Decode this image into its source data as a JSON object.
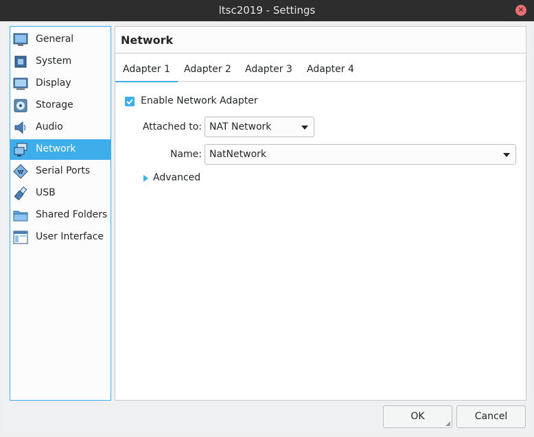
{
  "window": {
    "title": "ltsc2019 - Settings"
  },
  "sidebar": {
    "items": [
      {
        "label": "General",
        "icon": "general-icon"
      },
      {
        "label": "System",
        "icon": "system-icon"
      },
      {
        "label": "Display",
        "icon": "display-icon"
      },
      {
        "label": "Storage",
        "icon": "storage-icon"
      },
      {
        "label": "Audio",
        "icon": "audio-icon"
      },
      {
        "label": "Network",
        "icon": "network-icon",
        "selected": true
      },
      {
        "label": "Serial Ports",
        "icon": "serial-ports-icon"
      },
      {
        "label": "USB",
        "icon": "usb-icon"
      },
      {
        "label": "Shared Folders",
        "icon": "shared-folders-icon"
      },
      {
        "label": "User Interface",
        "icon": "user-interface-icon"
      }
    ]
  },
  "main": {
    "title": "Network",
    "tabs": [
      {
        "label": "Adapter 1",
        "active": true
      },
      {
        "label": "Adapter 2"
      },
      {
        "label": "Adapter 3"
      },
      {
        "label": "Adapter 4"
      }
    ],
    "enable_adapter": {
      "label": "Enable Network Adapter",
      "checked": true
    },
    "attached_to": {
      "label": "Attached to:",
      "value": "NAT Network"
    },
    "name": {
      "label": "Name:",
      "value": "NatNetwork"
    },
    "advanced": {
      "label": "Advanced",
      "expanded": false
    }
  },
  "buttons": {
    "ok": "OK",
    "cancel": "Cancel"
  },
  "colors": {
    "accent": "#3daee9",
    "titlebar": "#2d2d2d",
    "background": "#eff0f1",
    "close": "#e57373"
  }
}
